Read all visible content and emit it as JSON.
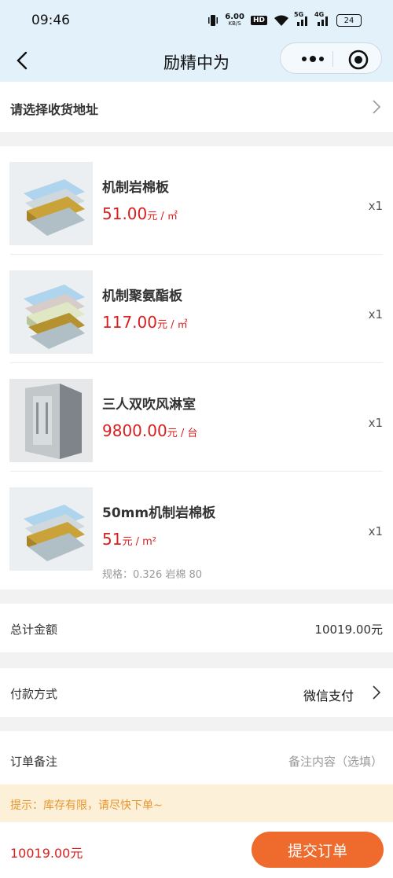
{
  "status_bar": {
    "time": "09:46",
    "net_speed": "6.00",
    "net_unit": "KB/S",
    "hd": "HD",
    "signal1": "5G",
    "signal2": "4G",
    "battery": "24"
  },
  "nav": {
    "title": "励精中为",
    "back_icon": "chevron-left-icon",
    "more_icon": "more-dots-icon",
    "close_icon": "target-close-icon"
  },
  "address": {
    "label": "请选择收货地址"
  },
  "products": [
    {
      "name": "机制岩棉板",
      "price": "51.00",
      "unit": "元 / ㎡",
      "qty": "x1",
      "spec": ""
    },
    {
      "name": "机制聚氨酯板",
      "price": "117.00",
      "unit": "元 / ㎡",
      "qty": "x1",
      "spec": ""
    },
    {
      "name": "三人双吹风淋室",
      "price": "9800.00",
      "unit": "元 / 台",
      "qty": "x1",
      "spec": ""
    },
    {
      "name": "50mm机制岩棉板",
      "price": "51",
      "unit": "元 / m²",
      "qty": "x1",
      "spec": "规格：0.326 岩棉 80"
    }
  ],
  "total": {
    "label": "总计金额",
    "value": "10019.00元"
  },
  "payment": {
    "label": "付款方式",
    "value": "微信支付"
  },
  "note": {
    "label": "订单备注",
    "placeholder": "备注内容（选填）"
  },
  "tip": "提示：库存有限，请尽快下单~",
  "bottom": {
    "total": "10019.00元",
    "submit_label": "提交订单"
  },
  "colors": {
    "header_bg": "#e3f1fb",
    "price_red": "#d81e1e",
    "submit_orange": "#ee6a2d",
    "tip_bg": "#fdf0d9",
    "tip_text": "#e8962d"
  }
}
